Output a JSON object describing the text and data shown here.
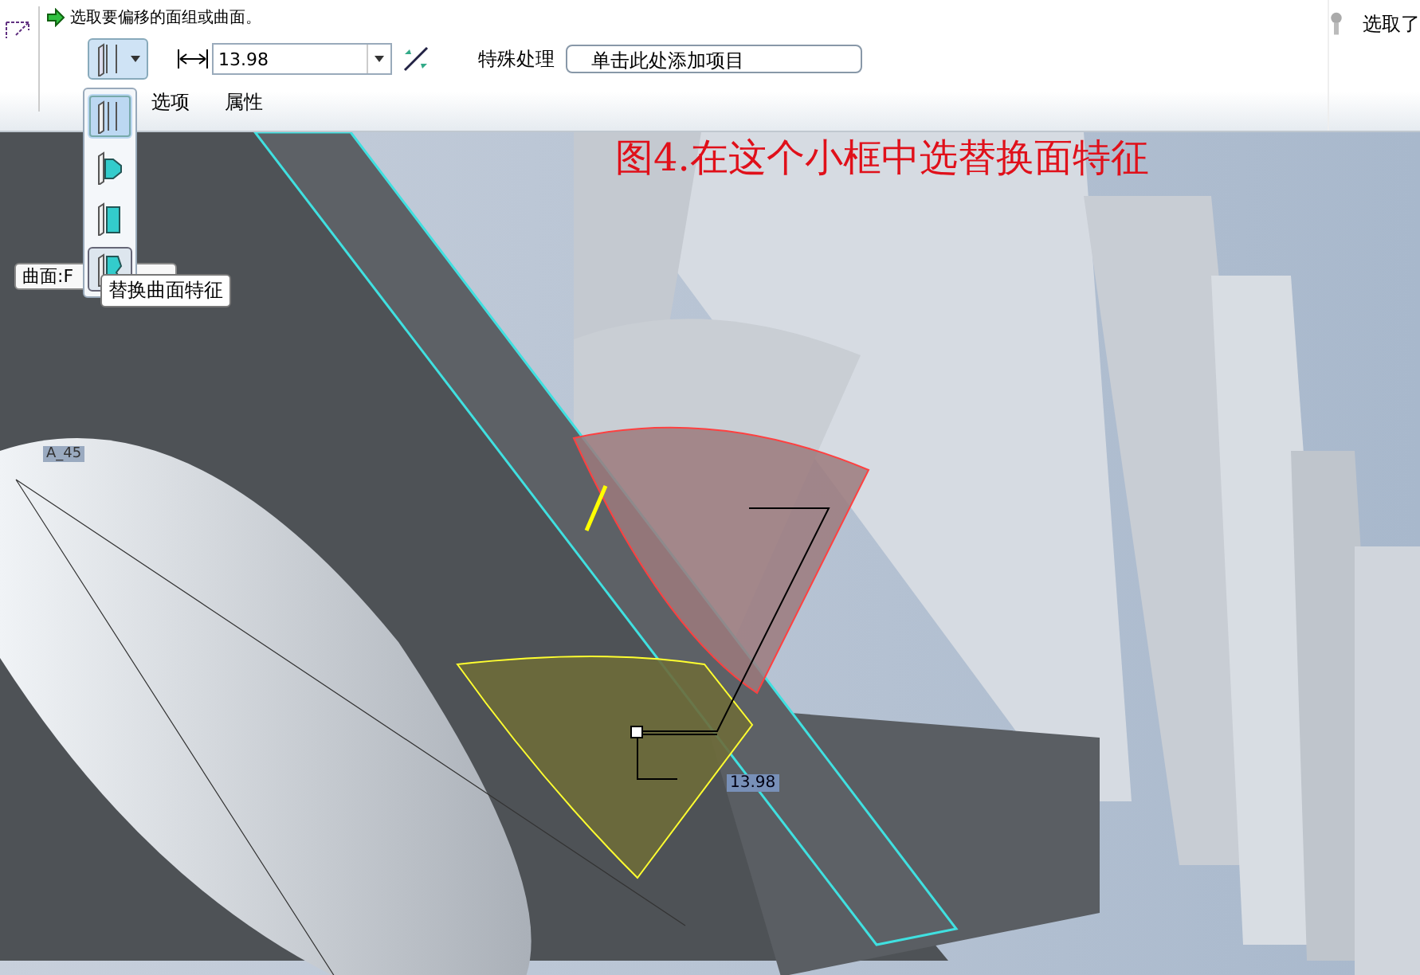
{
  "prompt": {
    "text": "选取要偏移的面组或曲面。"
  },
  "status_right": {
    "text": "选取了"
  },
  "toolbar": {
    "distance_value": "13.98",
    "special_label": "特殊处理",
    "special_button": "单击此处添加项目"
  },
  "offset_types": [
    {
      "kind": "standard",
      "selected": true,
      "highlighted": false
    },
    {
      "kind": "draft",
      "selected": false,
      "highlighted": false
    },
    {
      "kind": "expand",
      "selected": false,
      "highlighted": false
    },
    {
      "kind": "replace",
      "selected": false,
      "highlighted": true
    }
  ],
  "tooltip": "替换曲面特征",
  "tabs": [
    {
      "label": "选项"
    },
    {
      "label": "属性"
    }
  ],
  "viewport": {
    "annotation": "图4.在这个小框中选替换面特征",
    "surface_tag": "曲面:F",
    "angle_label": "A_45",
    "dimension_label": "13.98"
  }
}
